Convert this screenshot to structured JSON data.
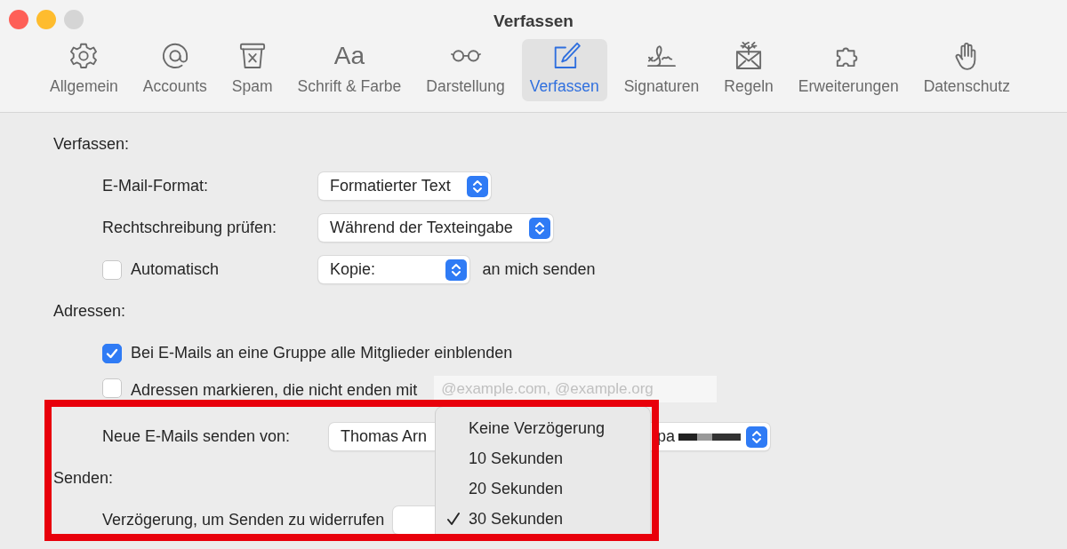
{
  "window": {
    "title": "Verfassen"
  },
  "toolbar": [
    {
      "label": "Allgemein",
      "selected": false
    },
    {
      "label": "Accounts",
      "selected": false
    },
    {
      "label": "Spam",
      "selected": false
    },
    {
      "label": "Schrift & Farbe",
      "selected": false,
      "icon_text": "Aa"
    },
    {
      "label": "Darstellung",
      "selected": false
    },
    {
      "label": "Verfassen",
      "selected": true
    },
    {
      "label": "Signaturen",
      "selected": false
    },
    {
      "label": "Regeln",
      "selected": false
    },
    {
      "label": "Erweiterungen",
      "selected": false
    },
    {
      "label": "Datenschutz",
      "selected": false
    }
  ],
  "sections": [
    {
      "heading": "Verfassen:",
      "rows": [
        {
          "kind": "popup",
          "label": "E-Mail-Format:",
          "value": "Formatierter Text"
        },
        {
          "kind": "popup",
          "label": "Rechtschreibung prüfen:",
          "value": "Während der Texteingabe"
        },
        {
          "kind": "checkpopup",
          "label": "Automatisch",
          "checked": false,
          "value": "Kopie:",
          "suffix": "an mich senden"
        }
      ]
    },
    {
      "heading": "Adressen:",
      "rows": [
        {
          "kind": "checkbox",
          "label": "Bei E-Mails an eine Gruppe alle Mitglieder einblenden",
          "checked": true
        },
        {
          "kind": "checkfield",
          "label": "Adressen markieren, die nicht enden mit",
          "checked": false,
          "placeholder": "@example.com, @example.org"
        },
        {
          "kind": "account",
          "label": "Neue E-Mails senden von:",
          "value": "Thomas Arn",
          "value_end": "pa"
        }
      ]
    },
    {
      "heading": "Senden:",
      "rows": [
        {
          "kind": "covered",
          "label": "Verzögerung, um Senden zu widerrufen"
        }
      ]
    }
  ],
  "menu": {
    "items": [
      {
        "label": "Keine Verzögerung",
        "selected": false
      },
      {
        "label": "10 Sekunden",
        "selected": false
      },
      {
        "label": "20 Sekunden",
        "selected": false
      },
      {
        "label": "30 Sekunden",
        "selected": true
      }
    ]
  }
}
